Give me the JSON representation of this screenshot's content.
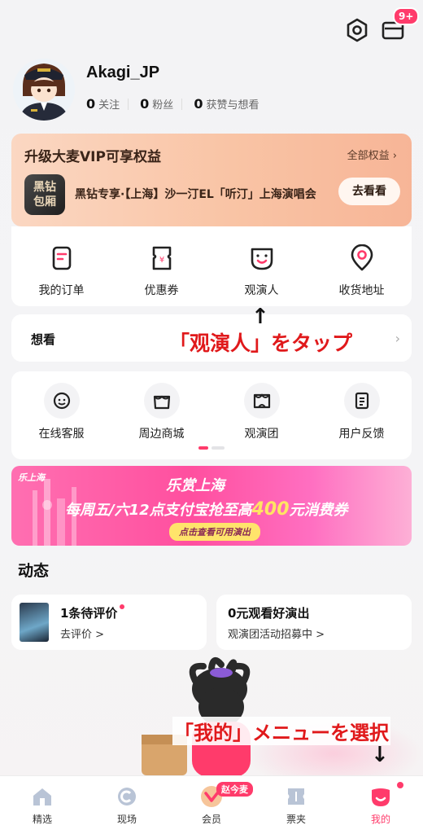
{
  "header": {
    "mail_badge": "9+"
  },
  "profile": {
    "username": "Akagi_JP",
    "stats": [
      {
        "count": "0",
        "label": "关注"
      },
      {
        "count": "0",
        "label": "粉丝"
      },
      {
        "count": "0",
        "label": "获赞与想看"
      }
    ]
  },
  "vip": {
    "title": "升级大麦VIP可享权益",
    "all_label": "全部权益",
    "logo_line1": "黑钻",
    "logo_line2": "包厢",
    "desc": "黑钻专享·【上海】沙一汀EL「听汀」上海演唱会",
    "button": "去看看"
  },
  "quick_actions": [
    {
      "label": "我的订单",
      "icon": "order-icon"
    },
    {
      "label": "优惠券",
      "icon": "coupon-icon"
    },
    {
      "label": "观演人",
      "icon": "audience-icon"
    },
    {
      "label": "收货地址",
      "icon": "location-icon"
    }
  ],
  "want": {
    "label": "想看"
  },
  "services": [
    {
      "label": "在线客服",
      "icon": "customer-service-icon"
    },
    {
      "label": "周边商城",
      "icon": "shop-icon"
    },
    {
      "label": "观演团",
      "icon": "group-icon"
    },
    {
      "label": "用户反馈",
      "icon": "feedback-icon"
    }
  ],
  "banner": {
    "tag": "乐上海",
    "title": "乐赏上海",
    "main_prefix": "每周五/六12点支付宝抢至高",
    "main_highlight": "400",
    "main_suffix": "元消费券",
    "pill": "点击查看可用演出"
  },
  "dynamics": {
    "title": "动态",
    "left": {
      "title": "1条待评价",
      "sub": "去评价 >"
    },
    "right": {
      "title": "0元观看好演出",
      "sub": "观演团活动招募中 >"
    }
  },
  "annotations": {
    "arrow_up": "↑",
    "tap_audience": "「观演人」をタップ",
    "select_mine": "「我的」メニューを選択",
    "arrow_down": "↓"
  },
  "bottom_nav": {
    "items": [
      {
        "label": "精选",
        "icon": "home-icon"
      },
      {
        "label": "现场",
        "icon": "live-icon"
      },
      {
        "label": "会员",
        "icon": "member-icon"
      },
      {
        "label": "票夹",
        "icon": "ticket-icon"
      },
      {
        "label": "我的",
        "icon": "profile-icon"
      }
    ],
    "member_pill": "赵今麦",
    "active": "我的"
  },
  "colors": {
    "accent": "#ff3b6b",
    "annotation": "#e0191b"
  }
}
